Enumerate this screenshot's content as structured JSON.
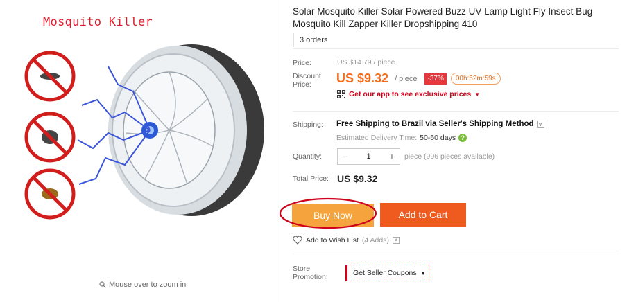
{
  "image_panel": {
    "overlay_title": "Mosquito Killer",
    "zoom_hint": "Mouse over to zoom in"
  },
  "product": {
    "title": "Solar Mosquito Killer Solar Powered Buzz UV Lamp Light Fly Insect Bug Mosquito Kill Zapper Killer Dropshipping 410",
    "orders": "3 orders"
  },
  "pricing": {
    "price_label": "Price:",
    "original_price": "US $14.79 / piece",
    "discount_label_line1": "Discount",
    "discount_label_line2": "Price:",
    "discount_price": "US $9.32",
    "per_piece": "/ piece",
    "discount_percent": "-37%",
    "countdown": "00h:52m:59s",
    "app_promo": "Get our app to see exclusive prices"
  },
  "shipping": {
    "label": "Shipping:",
    "method": "Free Shipping to Brazil via Seller's Shipping Method",
    "delivery_label": "Estimated Delivery Time:",
    "delivery_days": "50-60 days"
  },
  "quantity": {
    "label": "Quantity:",
    "value": "1",
    "minus": "−",
    "plus": "+",
    "availability": "piece (996 pieces available)"
  },
  "total": {
    "label": "Total Price:",
    "value": "US $9.32"
  },
  "actions": {
    "buy_now": "Buy Now",
    "add_to_cart": "Add to Cart",
    "wish_list": "Add to Wish List",
    "wish_count": "(4 Adds)"
  },
  "store": {
    "label_line1": "Store",
    "label_line2": "Promotion:",
    "coupon_button": "Get Seller Coupons"
  },
  "icons": {
    "qr": "qr-code-icon",
    "help": "help-icon",
    "heart": "heart-icon",
    "zoom": "magnifier-icon"
  },
  "colors": {
    "accent_orange": "#f56c1a",
    "buy_now": "#f5a33d",
    "add_to_cart": "#ef5a1e",
    "discount_red": "#e4393c",
    "highlight_red": "#d0021b"
  }
}
